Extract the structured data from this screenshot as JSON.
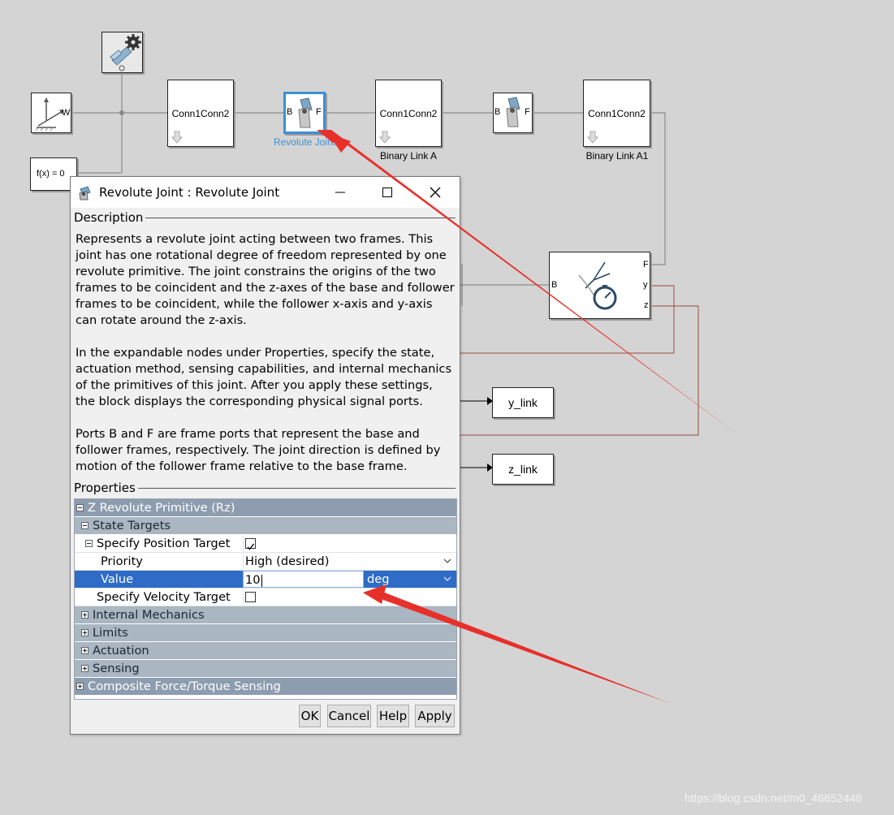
{
  "canvas": {
    "blocks": {
      "world_frame_port": "W",
      "fx_label": "f(x) = 0",
      "conn_label": "Conn1Conn2",
      "joint_port_b": "B",
      "joint_port_f": "F",
      "revolute_joint_caption": "Revolute Joint",
      "binary_link_a_caption": "Binary Link A",
      "binary_link_a1_caption": "Binary Link A1",
      "sensor_port_b": "B",
      "sensor_port_f": "F",
      "sensor_port_y": "y",
      "sensor_port_z": "z",
      "y_link_label": "y_link",
      "z_link_label": "z_link"
    }
  },
  "dialog": {
    "title": "Revolute Joint : Revolute Joint",
    "description_heading": "Description",
    "description_paragraphs": [
      "Represents a revolute joint acting between two frames. This joint has one rotational degree of freedom represented by one revolute primitive. The joint constrains the origins of the two frames to be coincident and the z-axes of the base and follower frames to be coincident, while the follower x-axis and y-axis can rotate around the z-axis.",
      "In the expandable nodes under Properties, specify the state, actuation method, sensing capabilities, and internal mechanics of the primitives of this joint. After you apply these settings, the block displays the corresponding physical signal ports.",
      "Ports B and F are frame ports that represent the base and follower frames, respectively. The joint direction is defined by motion of the follower frame relative to the base frame."
    ],
    "properties_heading": "Properties",
    "tree": {
      "primitive": "Z Revolute Primitive (Rz)",
      "state_targets": "State Targets",
      "specify_position_target": "Specify Position Target",
      "priority_label": "Priority",
      "priority_value": "High (desired)",
      "value_label": "Value",
      "value_input": "10",
      "value_unit": "deg",
      "specify_velocity_target": "Specify Velocity Target",
      "internal_mechanics": "Internal Mechanics",
      "limits": "Limits",
      "actuation": "Actuation",
      "sensing": "Sensing",
      "composite": "Composite Force/Torque Sensing"
    },
    "position_target_checked": true,
    "velocity_target_checked": false,
    "buttons": {
      "ok": "OK",
      "cancel": "Cancel",
      "help": "Help",
      "apply": "Apply"
    }
  },
  "watermark": "https://blog.csdn.net/m0_46652448",
  "colors": {
    "canvas_bg": "#d4d4d4",
    "selected_block": "#3c8fd6",
    "selected_row": "#2e6cc8",
    "section_header": "#aab6c2",
    "annotation_arrow": "#e8302a",
    "feedback_wire": "#a5635a"
  }
}
